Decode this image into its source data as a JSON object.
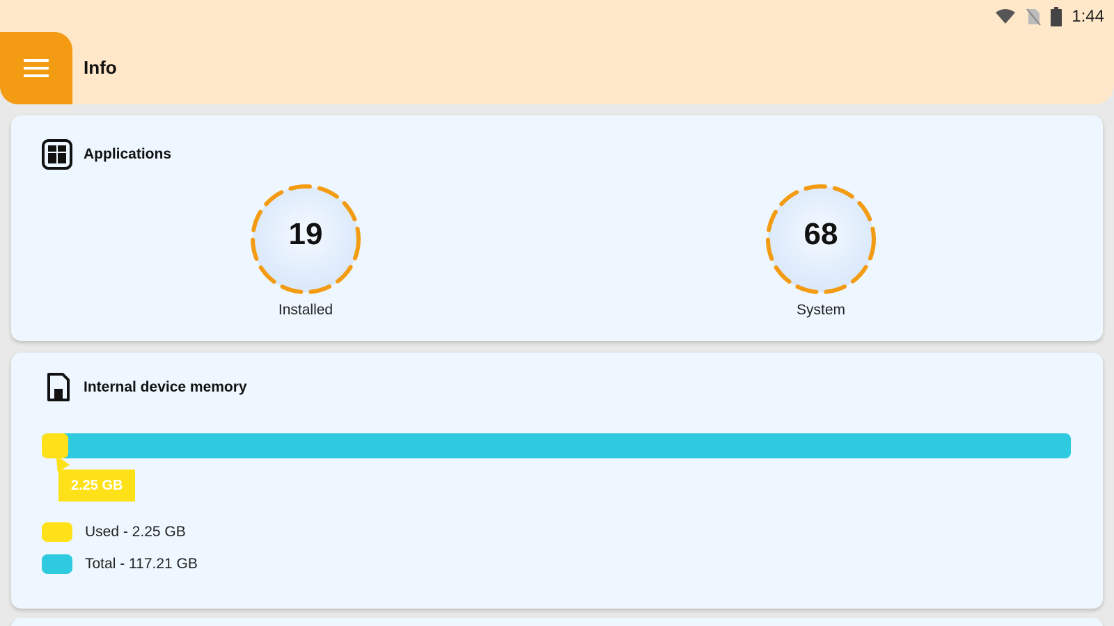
{
  "status_bar": {
    "time": "1:44",
    "icons": [
      "wifi-icon",
      "no-sim-icon",
      "battery-icon"
    ]
  },
  "app_bar": {
    "title": "Info",
    "menu_icon": "menu-icon"
  },
  "applications": {
    "label": "Applications",
    "icon": "apps-grid-icon",
    "installed": {
      "value": "19",
      "caption": "Installed"
    },
    "system": {
      "value": "68",
      "caption": "System"
    }
  },
  "memory": {
    "label": "Internal device memory",
    "icon": "sd-card-icon",
    "used_fraction": 0.0192,
    "bubble": "2.25 GB",
    "legend": [
      {
        "text": "Used - 2.25 GB",
        "color": "#ffe11a"
      },
      {
        "text": "Total - 117.21 GB",
        "color": "#2ecbe0"
      }
    ]
  },
  "colors": {
    "accent": "#f39b12",
    "app_bar": "#ffe7c9",
    "card": "#eef7ff",
    "used": "#ffe11a",
    "total": "#2ecbe0"
  }
}
